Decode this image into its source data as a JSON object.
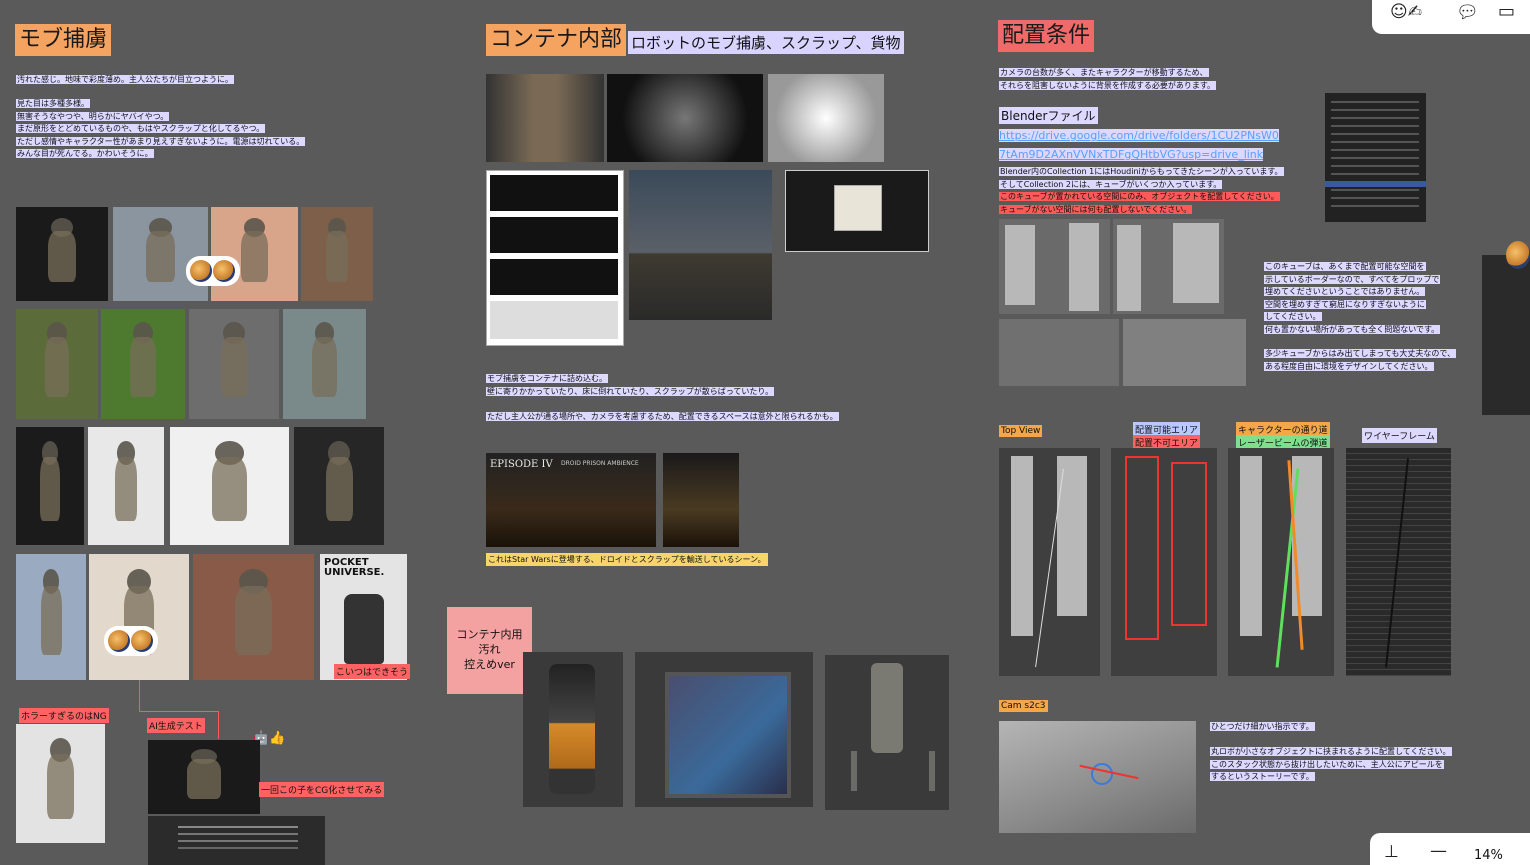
{
  "section1": {
    "title": "モブ捕虜",
    "note1": "汚れた感じ。地味で彩度薄め。主人公たちが目立つように。",
    "note2": [
      "見た目は多種多様。",
      "無害そうなやつや、明らかにヤバイやつ。",
      "まだ原形をとどめているものや、もはやスクラップと化してるやつ。",
      "ただし感情やキャラクター性があまり見えすぎないように。電源は切れている。",
      "みんな目が死んでる。かわいそうに。"
    ],
    "tag_ok": "こいつはできそう",
    "tag_ng": "ホラーすぎるのはNG",
    "tag_ai": "AI生成テスト",
    "tag_cg": "一回この子をCG化させてみる",
    "emoji": "🤖👍"
  },
  "section2": {
    "title": "コンテナ内部",
    "subtitle": "ロボットのモブ捕虜、スクラップ、貨物",
    "note1": [
      "モブ捕虜をコンテナに詰め込む。",
      "壁に寄りかかっていたり、床に倒れていたり、スクラップが散らばっていたり。"
    ],
    "note2": "ただし主人公が通る場所や、カメラを考慮するため、配置できるスペースは意外と限られるかも。",
    "episode_title": "EPISODE IV",
    "episode_sub": "DROID PRISON AMBIENCE",
    "note3": "これはStar Warsに登場する、ドロイドとスクラップを輸送しているシーン。",
    "pink_box": [
      "コンテナ内用",
      "汚れ",
      "控えめver"
    ]
  },
  "section3": {
    "title": "配置条件",
    "note1": [
      "カメラの台数が多く、またキャラクターが移動するため、",
      "それらを阻害しないように背景を作成する必要があります。"
    ],
    "blender_label": "Blenderファイル",
    "blender_link": [
      "https://drive.google.com/drive/folders/1CU2PNsW0",
      "7tAm9D2AXnVVNxTDFgQHtbVG?usp=drive_link"
    ],
    "note2": [
      "Blender内のCollection 1にはHoudiniからもってきたシーンが入っています。",
      "そしてCollection 2には、キューブがいくつか入っています。",
      "このキューブが置かれている空間にのみ、オブジェクトを配置してください。",
      "キューブがない空間には何も配置しないでください。"
    ],
    "note3": [
      "このキューブは、あくまで配置可能な空間を",
      "示しているボーダーなので、すべてをプロップで",
      "埋めてくださいということではありません。",
      "空間を埋めすぎて窮屈になりすぎないように",
      "してください。",
      "何も置かない場所があっても全く問題ないです。"
    ],
    "note4": [
      "多少キューブからはみ出てしまっても大丈夫なので、",
      "ある程度自由に環境をデザインしてください。"
    ],
    "top_view": "Top View",
    "area_ok": "配置可能エリア",
    "area_ng": "配置不可エリア",
    "char_path": "キャラクターの通り道",
    "laser": "レーザービームの弾道",
    "wireframe": "ワイヤーフレーム",
    "cam": "Cam s2c3",
    "note5": "ひとつだけ細かい指示です。",
    "note6": [
      "丸ロボが小さなオブジェクトに挟まれるように配置してください。",
      "このスタック状態から抜け出したいために、主人公にアピールを",
      "するというストーリーです。"
    ]
  },
  "toolbar": {
    "zoom": "14%"
  },
  "colors": {
    "canvas": "#5a5a5a",
    "title_orange": "#f4a460",
    "title_red": "#f06a6a",
    "highlight": "#dcd8ff"
  }
}
